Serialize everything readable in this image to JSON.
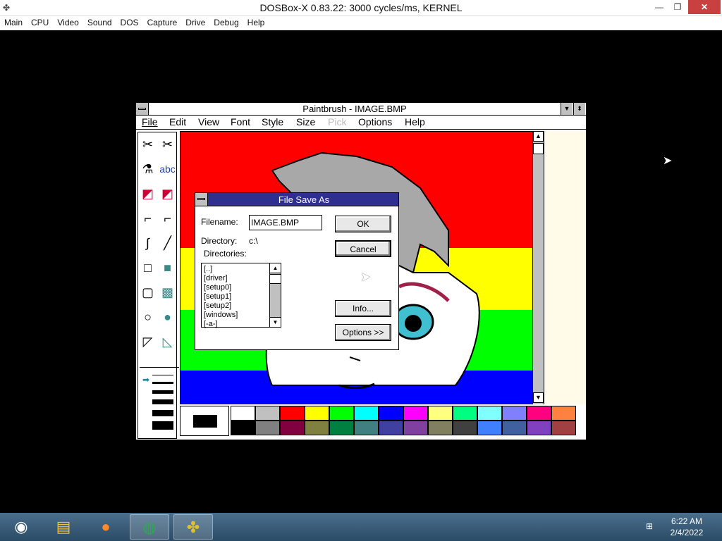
{
  "host": {
    "title": "DOSBox-X 0.83.22: 3000 cycles/ms, KERNEL",
    "menu": [
      "Main",
      "CPU",
      "Video",
      "Sound",
      "DOS",
      "Capture",
      "Drive",
      "Debug",
      "Help"
    ],
    "minimize": "—",
    "restore": "❐",
    "close": "✕"
  },
  "paintbrush": {
    "title": "Paintbrush - IMAGE.BMP",
    "menu": [
      "File",
      "Edit",
      "View",
      "Font",
      "Style",
      "Size",
      "Pick",
      "Options",
      "Help"
    ],
    "tools": [
      "✂",
      "✂",
      "⚗",
      "abc",
      "◩",
      "◩",
      "⌐",
      "⌐",
      "∫",
      "╱",
      "□",
      "■",
      "▢",
      "▩",
      "○",
      "●",
      "◸",
      "◺"
    ],
    "palette_colors": [
      "#ffffff",
      "#c0c0c0",
      "#ff0000",
      "#ffff00",
      "#00ff00",
      "#00ffff",
      "#0000ff",
      "#ff00ff",
      "#ffff80",
      "#00ff80",
      "#80ffff",
      "#8080ff",
      "#ff0080",
      "#ff8040",
      "#000000",
      "#808080",
      "#800040",
      "#808040",
      "#008040",
      "#408080",
      "#4040a0",
      "#8040a0",
      "#808060",
      "#404040",
      "#4080ff",
      "#4060a0",
      "#8040c0",
      "#a04040"
    ],
    "stripe_colors": [
      "#ff0000",
      "#ffff00",
      "#00ff00",
      "#0000ff"
    ]
  },
  "dialog": {
    "title": "File Save As",
    "filename_label": "Filename:",
    "filename_value": "IMAGE.BMP",
    "directory_label": "Directory:",
    "directory_value": "c:\\",
    "directories_label": "Directories:",
    "directories": [
      "[..]",
      "[driver]",
      "[setup0]",
      "[setup1]",
      "[setup2]",
      "[windows]",
      "[-a-]"
    ],
    "ok": "OK",
    "cancel": "Cancel",
    "info": "Info...",
    "options": "Options >>"
  },
  "taskbar": {
    "time": "6:22 AM",
    "date": "2/4/2022",
    "apps": [
      "start-orb-icon",
      "file-explorer-icon",
      "firefox-icon",
      "chrome-icon",
      "dosbox-icon"
    ]
  }
}
